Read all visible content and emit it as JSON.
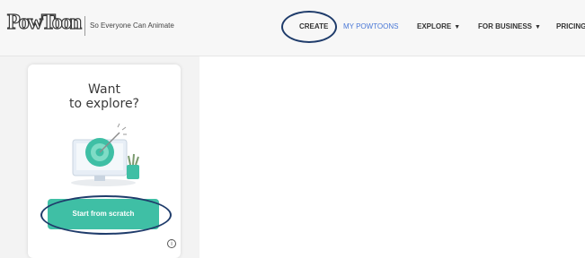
{
  "header": {
    "logo_text": "PowToon",
    "tagline": "So Everyone Can Animate",
    "nav": {
      "create": "CREATE",
      "my_powtoons": "MY POWTOONS",
      "explore": "EXPLORE",
      "for_business": "FOR BUSINESS",
      "pricing": "PRICING",
      "caret": "▼"
    }
  },
  "card": {
    "title_line1": "Want",
    "title_line2": "to explore?",
    "button_label": "Start from scratch",
    "info_glyph": "i"
  },
  "colors": {
    "accent_teal": "#3fbfa5",
    "link_blue": "#4a78d6",
    "annotation_navy": "#1f3c6b"
  }
}
